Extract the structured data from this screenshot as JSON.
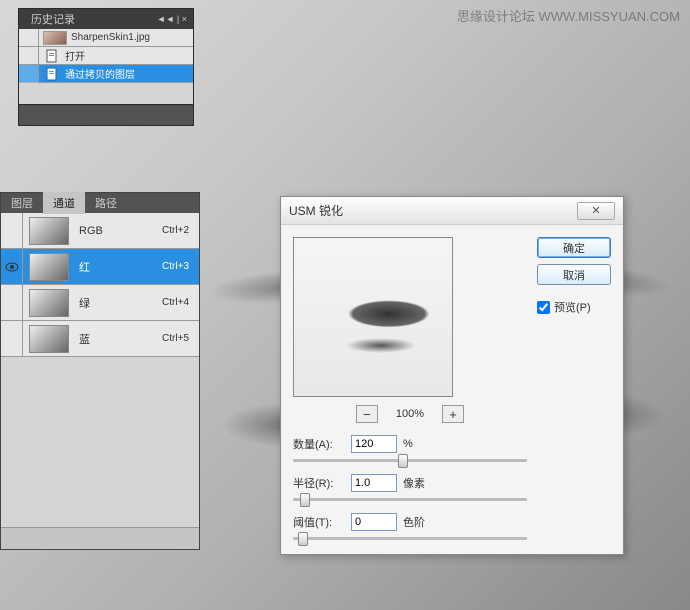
{
  "watermark": "思缘设计论坛  WWW.MISSYUAN.COM",
  "history": {
    "title": "历史记录",
    "items": [
      {
        "label": "SharpenSkin1.jpg",
        "type": "doc"
      },
      {
        "label": "打开",
        "type": "step"
      },
      {
        "label": "通过拷贝的图层",
        "type": "step",
        "selected": true
      }
    ]
  },
  "channels": {
    "tabs": [
      "图层",
      "通道",
      "路径"
    ],
    "activeTab": 1,
    "rows": [
      {
        "name": "RGB",
        "shortcut": "Ctrl+2"
      },
      {
        "name": "红",
        "shortcut": "Ctrl+3",
        "selected": true,
        "eye": true
      },
      {
        "name": "绿",
        "shortcut": "Ctrl+4"
      },
      {
        "name": "蓝",
        "shortcut": "Ctrl+5"
      }
    ]
  },
  "usm": {
    "title": "USM 锐化",
    "ok": "确定",
    "cancel": "取消",
    "preview_label": "预览(P)",
    "preview_checked": true,
    "zoom": "100%",
    "amount_label": "数量(A):",
    "amount_value": "120",
    "amount_unit": "%",
    "radius_label": "半径(R):",
    "radius_value": "1.0",
    "radius_unit": "像素",
    "threshold_label": "阈值(T):",
    "threshold_value": "0",
    "threshold_unit": "色阶",
    "amount_pos": "45%",
    "radius_pos": "3%",
    "threshold_pos": "2%"
  }
}
